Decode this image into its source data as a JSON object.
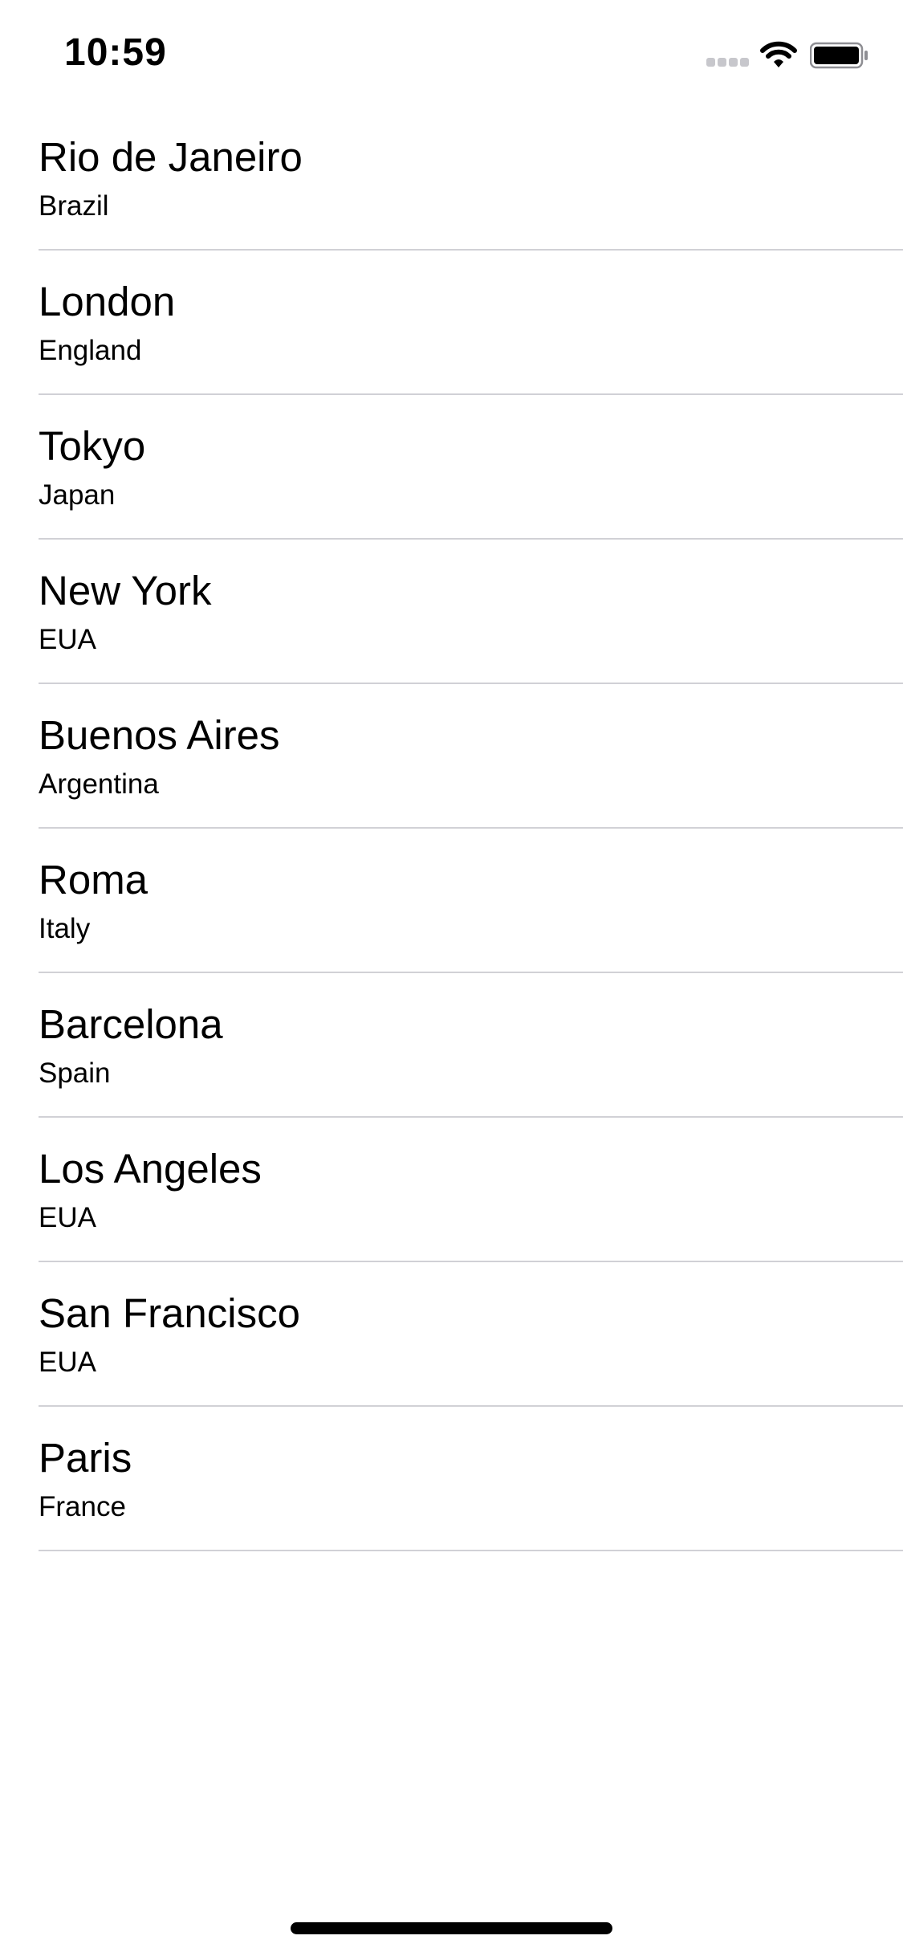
{
  "status_bar": {
    "time": "10:59",
    "signal_icon": "cellular-signal-icon",
    "wifi_icon": "wifi-icon",
    "battery_icon": "battery-icon"
  },
  "cities": [
    {
      "name": "Rio de Janeiro",
      "country": "Brazil"
    },
    {
      "name": "London",
      "country": "England"
    },
    {
      "name": "Tokyo",
      "country": "Japan"
    },
    {
      "name": "New York",
      "country": "EUA"
    },
    {
      "name": "Buenos Aires",
      "country": "Argentina"
    },
    {
      "name": "Roma",
      "country": "Italy"
    },
    {
      "name": "Barcelona",
      "country": "Spain"
    },
    {
      "name": "Los Angeles",
      "country": "EUA"
    },
    {
      "name": "San Francisco",
      "country": "EUA"
    },
    {
      "name": "Paris",
      "country": "France"
    }
  ],
  "colors": {
    "background": "#ffffff",
    "text": "#000000",
    "separator": "#d1d1d6",
    "inactive_signal": "#c7c7cc"
  }
}
